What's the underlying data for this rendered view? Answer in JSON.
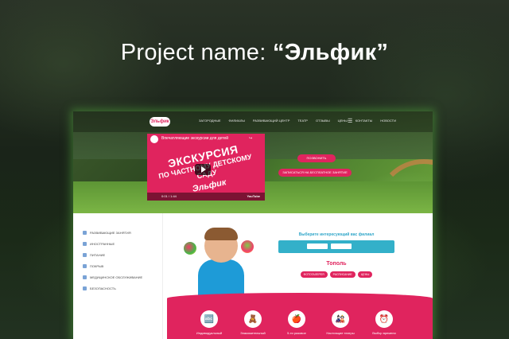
{
  "headline": {
    "prefix": "Project name:",
    "name": "“Эльфик”"
  },
  "site": {
    "logo_text": "Эльфик",
    "nav": [
      "ЗАГОРОДНЫЕ",
      "ФИЛИАЛЫ",
      "РАЗВИВАЮЩИЙ ЦЕНТР",
      "ТЕАТР",
      "ОТЗЫВЫ",
      "ЦЕНЫ",
      "КОНТАКТЫ",
      "НОВОСТИ"
    ],
    "video": {
      "title": "Впечатляющие экскурсии для детей",
      "share": "Поделиться",
      "line1": "ЭКСКУРСИЯ",
      "line2": "ПО ЧАСТНОМУ ДЕТСКОМУ САДУ",
      "line3": "Эльфик",
      "time": "0:01 / 1:44",
      "brand": "YouTube"
    },
    "call_button": "ПОЗВОНИТЬ",
    "free_button": "ЗАПИСАТЬСЯ НА БЕСПЛАТНОЕ ЗАНЯТИЕ",
    "sidebar": [
      "РАЗВИВАЮЩИЕ ЗАНЯТИЯ",
      "ИНОСТРАННЫЕ",
      "ПИТАНИЕ",
      "ПОКРЫВ",
      "МЕДИЦИНСКОЕ ОБСЛУЖИВАНИЕ",
      "БЕЗОПАСНОСТЬ"
    ],
    "panel": {
      "title": "Выберите интересующий вас филиал",
      "chip1": "",
      "chip2": "",
      "city": "Тополь",
      "tabs": [
        "ФОТОГАЛЕРЕЯ",
        "РАСПИСАНИЕ",
        "ЦЕНЫ"
      ]
    },
    "features": [
      {
        "icon": "🔤",
        "label": "Индивидуальный"
      },
      {
        "icon": "🧸",
        "label": "Знакомительный"
      },
      {
        "icon": "🍎",
        "label": "5-ти разовое"
      },
      {
        "icon": "🎎",
        "label": "Настоящие театры"
      },
      {
        "icon": "⏰",
        "label": "Выбор времени"
      }
    ]
  }
}
